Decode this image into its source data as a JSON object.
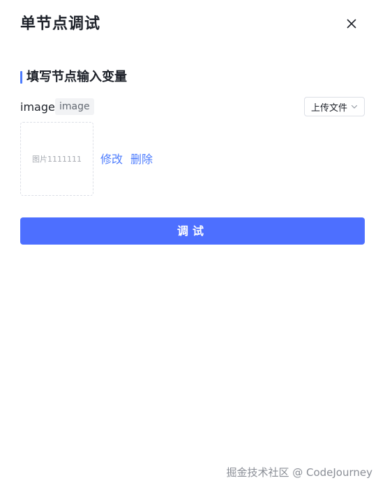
{
  "dialog": {
    "title": "单节点调试",
    "close_icon": "close-icon"
  },
  "section": {
    "title": "填写节点输入变量",
    "accent_color": "#4d7cfe"
  },
  "variable": {
    "name": "image",
    "type": "image",
    "upload_select_label": "上传文件",
    "chevron_icon": "chevron-down-icon"
  },
  "image_preview": {
    "placeholder": "图片1111111"
  },
  "actions": {
    "edit_label": "修改",
    "delete_label": "删除",
    "link_color": "#4d7cfe"
  },
  "debug_button": {
    "label": "调试",
    "color": "#4d6fff"
  },
  "watermark": {
    "text": "掘金技术社区 @ CodeJourney"
  }
}
